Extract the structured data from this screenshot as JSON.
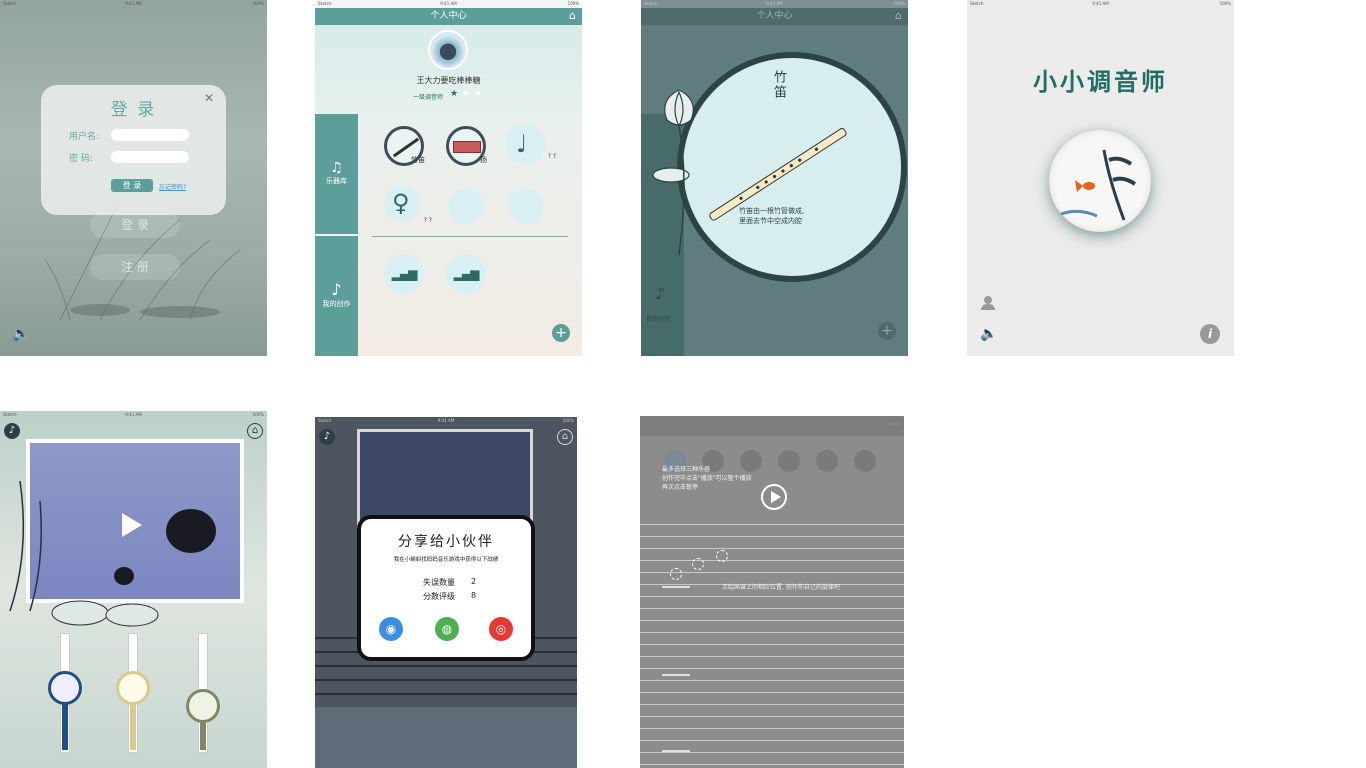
{
  "status_bar": {
    "carrier": "Sketch",
    "time": "9:41 AM",
    "battery": "100%"
  },
  "s1": {
    "title": "登 录",
    "username_label": "用户名:",
    "password_label": "密 码:",
    "login_btn": "登 录",
    "forgot": "忘记密码?",
    "bg_login": "登 录",
    "bg_register": "注 册"
  },
  "s2": {
    "header": "个人中心",
    "user_name": "王大力要吃棒棒糖",
    "level": "一级调音师",
    "side_lib": "乐器库",
    "side_works": "我的创作",
    "inst1": "竹笛",
    "inst2": "扬",
    "qq": "? ?"
  },
  "s3": {
    "header": "个人中心",
    "title": "竹笛",
    "desc1": "竹笛由一根竹管做成,",
    "desc2": "里面去节中空成内腔",
    "works": "我的创作"
  },
  "s4": {
    "title": "小小调音师"
  },
  "s6": {
    "title": "分享给小伙伴",
    "subtitle": "我在小蝌蚪找妈妈音乐游戏中获得以下战绩",
    "row1_label": "失误数量",
    "row1_value": "2",
    "row2_label": "分数评级",
    "row2_value": "8"
  },
  "s7": {
    "tip1": "最多选择三种乐器",
    "tip2": "创作完毕点击\"播放\"可以整个播放",
    "tip3": "再次点击暂停",
    "hint": "点绘画谱上的相应位置, 创作你自己的旋律吧"
  },
  "colors": {
    "teal": "#5c9e99",
    "dark_teal": "#2f6b66",
    "slate": "#5f7c7f"
  }
}
